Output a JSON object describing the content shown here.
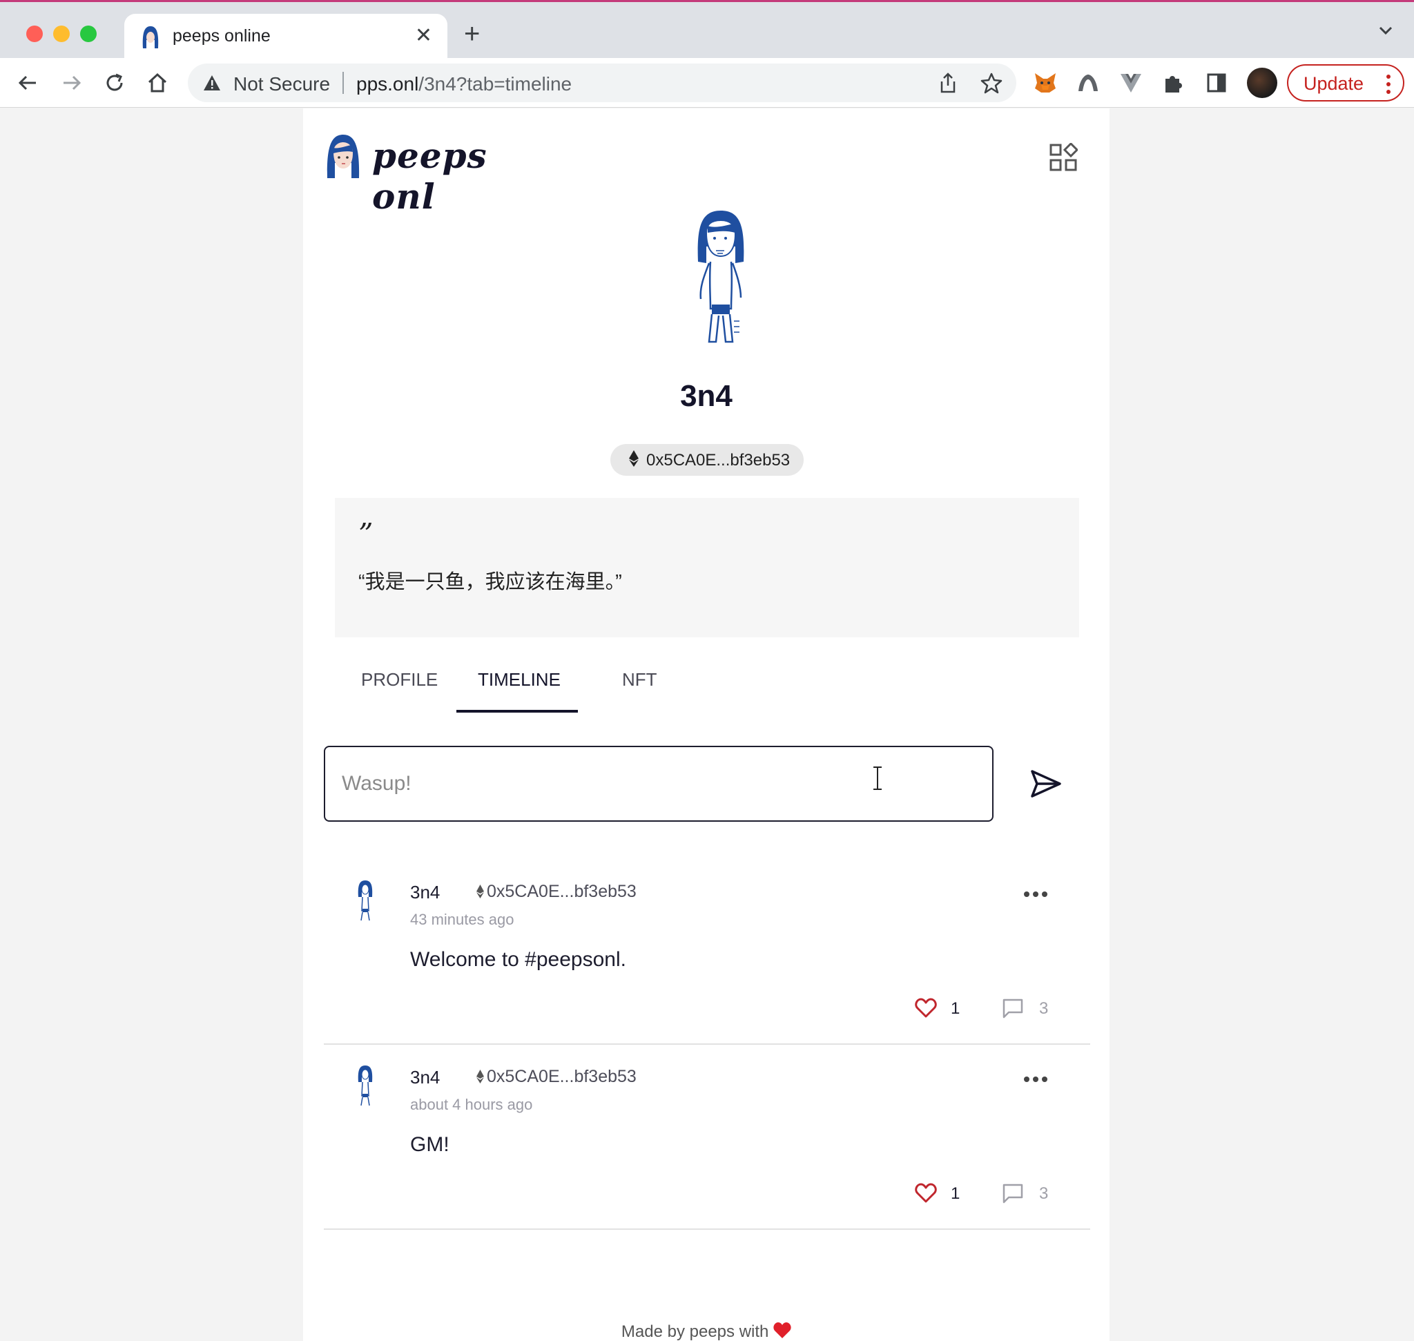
{
  "browser": {
    "tab_title": "peeps online",
    "address_warning": "Not Secure",
    "url_host": "pps.onl",
    "url_path": "/3n4?tab=timeline",
    "update_label": "Update"
  },
  "site": {
    "logo_text": "peeps onl"
  },
  "profile": {
    "username": "3n4",
    "address": "0x5CA0E...bf3eb53",
    "quote_mark": "”",
    "bio": "“我是一只鱼，我应该在海里。”"
  },
  "tabs": [
    {
      "label": "PROFILE",
      "active": false
    },
    {
      "label": "TIMELINE",
      "active": true
    },
    {
      "label": "NFT",
      "active": false
    }
  ],
  "composer": {
    "placeholder": "Wasup!"
  },
  "posts": [
    {
      "author": "3n4",
      "address": "0x5CA0E...bf3eb53",
      "time": "43 minutes ago",
      "text": "Welcome to #peepsonl.",
      "likes": "1",
      "comments": "3"
    },
    {
      "author": "3n4",
      "address": "0x5CA0E...bf3eb53",
      "time": "about 4 hours ago",
      "text": "GM!",
      "likes": "1",
      "comments": "3"
    }
  ],
  "footer": {
    "text": "Made by peeps with"
  },
  "colors": {
    "accent": "#14142a",
    "brand_blue": "#1f4fa0",
    "like_red": "#c0262d",
    "update_red": "#c5221f"
  }
}
